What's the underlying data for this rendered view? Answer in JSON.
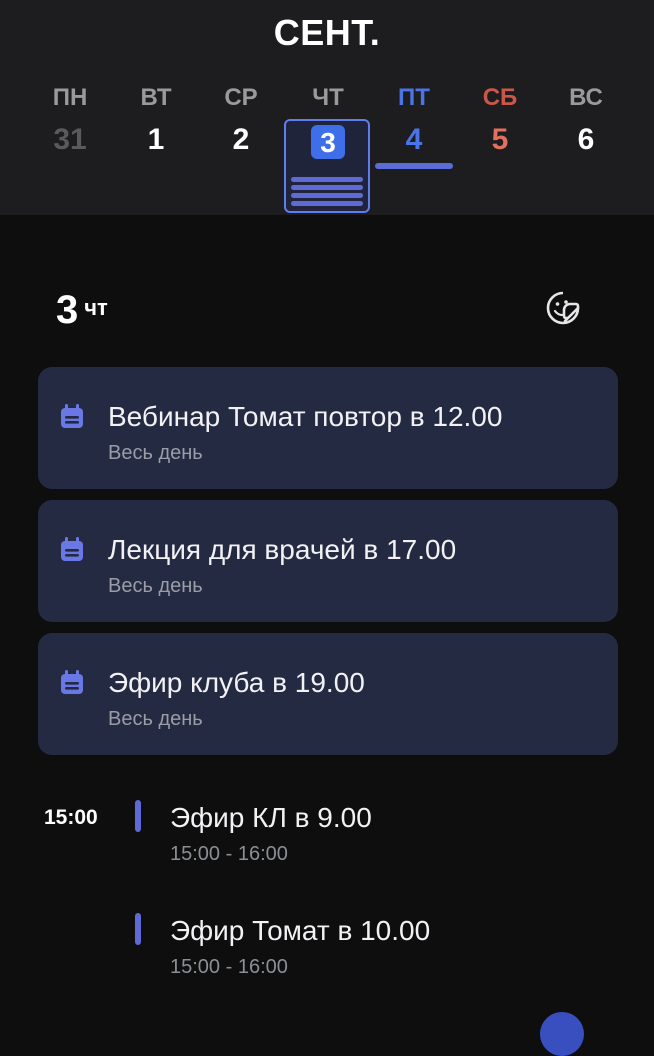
{
  "header": {
    "month": "СЕНТ.",
    "days": [
      {
        "weekday": "ПН",
        "num": "31"
      },
      {
        "weekday": "ВТ",
        "num": "1"
      },
      {
        "weekday": "СР",
        "num": "2"
      },
      {
        "weekday": "ЧТ",
        "num": "3"
      },
      {
        "weekday": "ПТ",
        "num": "4"
      },
      {
        "weekday": "СБ",
        "num": "5"
      },
      {
        "weekday": "ВС",
        "num": "6"
      }
    ]
  },
  "selected_day": {
    "number": "3",
    "weekday": "чт"
  },
  "all_day_events": [
    {
      "title": "Вебинар Томат повтор в 12.00",
      "subtitle": "Весь день"
    },
    {
      "title": "Лекция для врачей в 17.00",
      "subtitle": "Весь день"
    },
    {
      "title": "Эфир клуба в 19.00",
      "subtitle": "Весь день"
    }
  ],
  "timed": {
    "time_label": "15:00",
    "events": [
      {
        "title": "Эфир КЛ в 9.00",
        "time": "15:00 - 16:00"
      },
      {
        "title": "Эфир Томат в 10.00",
        "time": "15:00 - 16:00"
      }
    ]
  },
  "colors": {
    "accent": "#3f6fe8",
    "card_bg": "#252a43",
    "friday": "#4b74e6",
    "saturday": "#e0705f",
    "muted": "#6b6b6e"
  },
  "icons": {
    "event": "calendar-icon",
    "sticker": "sticker-icon"
  }
}
